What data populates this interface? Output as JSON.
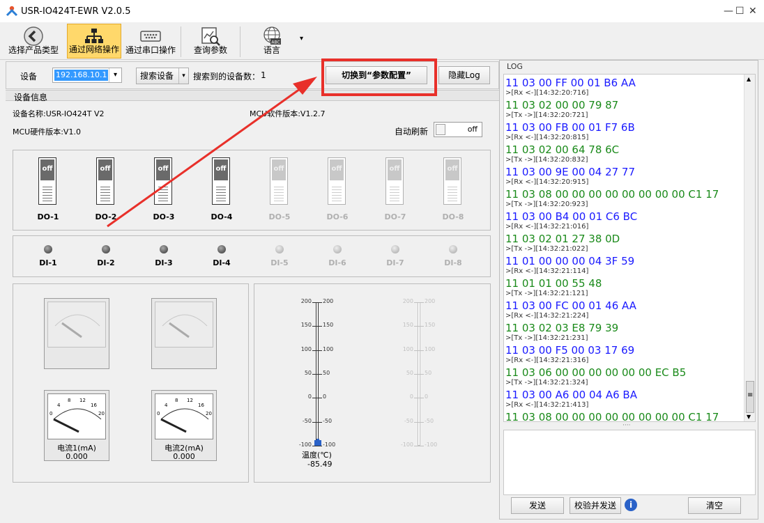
{
  "window": {
    "title": "USR-IO424T-EWR V2.0.5",
    "min": "—",
    "max": "☐",
    "close": "✕"
  },
  "toolbar": {
    "select_product": "选择产品类型",
    "network_op": "通过网络操作",
    "serial_op": "通过串口操作",
    "query_params": "查询参数",
    "language": "语言",
    "dropdown": "▾",
    "abc": "ABC"
  },
  "device": {
    "label": "设备",
    "ip": "192.168.10.1",
    "search_button": "搜索设备",
    "found_label": "搜索到的设备数：",
    "found_count": "1",
    "switch_button": "切换到“参数配置”",
    "hide_log_button": "隐藏Log",
    "combo_arrow": "▾"
  },
  "info": {
    "section_title": "设备信息",
    "device_name": "设备名称:USR-IO424T V2",
    "mcu_sw": "MCU软件版本:V1.2.7",
    "mcu_hw": "MCU硬件版本:V1.0",
    "auto_refresh_label": "自动刷新",
    "auto_refresh_value": "off"
  },
  "do_switches": [
    {
      "label": "DO-1",
      "state": "off",
      "enabled": true
    },
    {
      "label": "DO-2",
      "state": "off",
      "enabled": true
    },
    {
      "label": "DO-3",
      "state": "off",
      "enabled": true
    },
    {
      "label": "DO-4",
      "state": "off",
      "enabled": true
    },
    {
      "label": "DO-5",
      "state": "off",
      "enabled": false
    },
    {
      "label": "DO-6",
      "state": "off",
      "enabled": false
    },
    {
      "label": "DO-7",
      "state": "off",
      "enabled": false
    },
    {
      "label": "DO-8",
      "state": "off",
      "enabled": false
    }
  ],
  "di_inputs": [
    {
      "label": "DI-1",
      "enabled": true
    },
    {
      "label": "DI-2",
      "enabled": true
    },
    {
      "label": "DI-3",
      "enabled": true
    },
    {
      "label": "DI-4",
      "enabled": true
    },
    {
      "label": "DI-5",
      "enabled": false
    },
    {
      "label": "DI-6",
      "enabled": false
    },
    {
      "label": "DI-7",
      "enabled": false
    },
    {
      "label": "DI-8",
      "enabled": false
    }
  ],
  "gauges": {
    "ticks": [
      "0",
      "4",
      "8",
      "12",
      "16",
      "20"
    ],
    "current1": {
      "label": "电流1(mA)",
      "value": "0.000"
    },
    "current2": {
      "label": "电流2(mA)",
      "value": "0.000"
    }
  },
  "thermometer": {
    "ticks": [
      "200",
      "150",
      "100",
      "50",
      "0",
      "-50",
      "-100"
    ],
    "label": "温度(℃)",
    "value": "-85.49"
  },
  "log": {
    "title": "LOG",
    "lines": [
      {
        "t": "hex",
        "c": "rx",
        "s": "11 03 00 FF 00 01 B6 AA"
      },
      {
        "t": "ts",
        "s": ">[Rx <-][14:32:20:716]"
      },
      {
        "t": "hex",
        "c": "tx2",
        "s": "11 03 02 00 00 79 87"
      },
      {
        "t": "ts",
        "s": ">[Tx ->][14:32:20:721]"
      },
      {
        "t": "hex",
        "c": "rx",
        "s": "11 03 00 FB 00 01 F7 6B"
      },
      {
        "t": "ts",
        "s": ">[Rx <-][14:32:20:815]"
      },
      {
        "t": "hex",
        "c": "tx2",
        "s": "11 03 02 00 64 78 6C"
      },
      {
        "t": "ts",
        "s": ">[Tx ->][14:32:20:832]"
      },
      {
        "t": "hex",
        "c": "rx",
        "s": "11 03 00 9E 00 04 27 77"
      },
      {
        "t": "ts",
        "s": ">[Rx <-][14:32:20:915]"
      },
      {
        "t": "hex",
        "c": "tx2",
        "s": "11 03 08 00 00 00 00 00 00 00 00 C1 17"
      },
      {
        "t": "ts",
        "s": ">[Tx ->][14:32:20:923]"
      },
      {
        "t": "hex",
        "c": "rx",
        "s": "11 03 00 B4 00 01 C6 BC"
      },
      {
        "t": "ts",
        "s": ">[Rx <-][14:32:21:016]"
      },
      {
        "t": "hex",
        "c": "tx2",
        "s": "11 03 02 01 27 38 0D"
      },
      {
        "t": "ts",
        "s": ">[Tx ->][14:32:21:022]"
      },
      {
        "t": "hex",
        "c": "rx",
        "s": "11 01 00 00 00 04 3F 59"
      },
      {
        "t": "ts",
        "s": ">[Rx <-][14:32:21:114]"
      },
      {
        "t": "hex",
        "c": "tx2",
        "s": "11 01 01 00 55 48"
      },
      {
        "t": "ts",
        "s": ">[Tx ->][14:32:21:121]"
      },
      {
        "t": "hex",
        "c": "rx",
        "s": "11 03 00 FC 00 01 46 AA"
      },
      {
        "t": "ts",
        "s": ">[Rx <-][14:32:21:224]"
      },
      {
        "t": "hex",
        "c": "tx2",
        "s": "11 03 02 03 E8 79 39"
      },
      {
        "t": "ts",
        "s": ">[Tx ->][14:32:21:231]"
      },
      {
        "t": "hex",
        "c": "rx",
        "s": "11 03 00 F5 00 03 17 69"
      },
      {
        "t": "ts",
        "s": ">[Rx <-][14:32:21:316]"
      },
      {
        "t": "hex",
        "c": "tx2",
        "s": "11 03 06 00 00 00 00 00 00 EC B5"
      },
      {
        "t": "ts",
        "s": ">[Tx ->][14:32:21:324]"
      },
      {
        "t": "hex",
        "c": "rx",
        "s": "11 03 00 A6 00 04 A6 BA"
      },
      {
        "t": "ts",
        "s": ">[Rx <-][14:32:21:413]"
      },
      {
        "t": "hex",
        "c": "tx2",
        "s": "11 03 08 00 00 00 00 00 00 00 00 C1 17"
      }
    ],
    "send_button": "发送",
    "checksum_send_button": "校验并发送",
    "info_icon": "i",
    "clear_button": "清空",
    "splitter": "····",
    "scroll_up": "▲",
    "scroll_down": "▼",
    "thumb_grip": "≡"
  }
}
